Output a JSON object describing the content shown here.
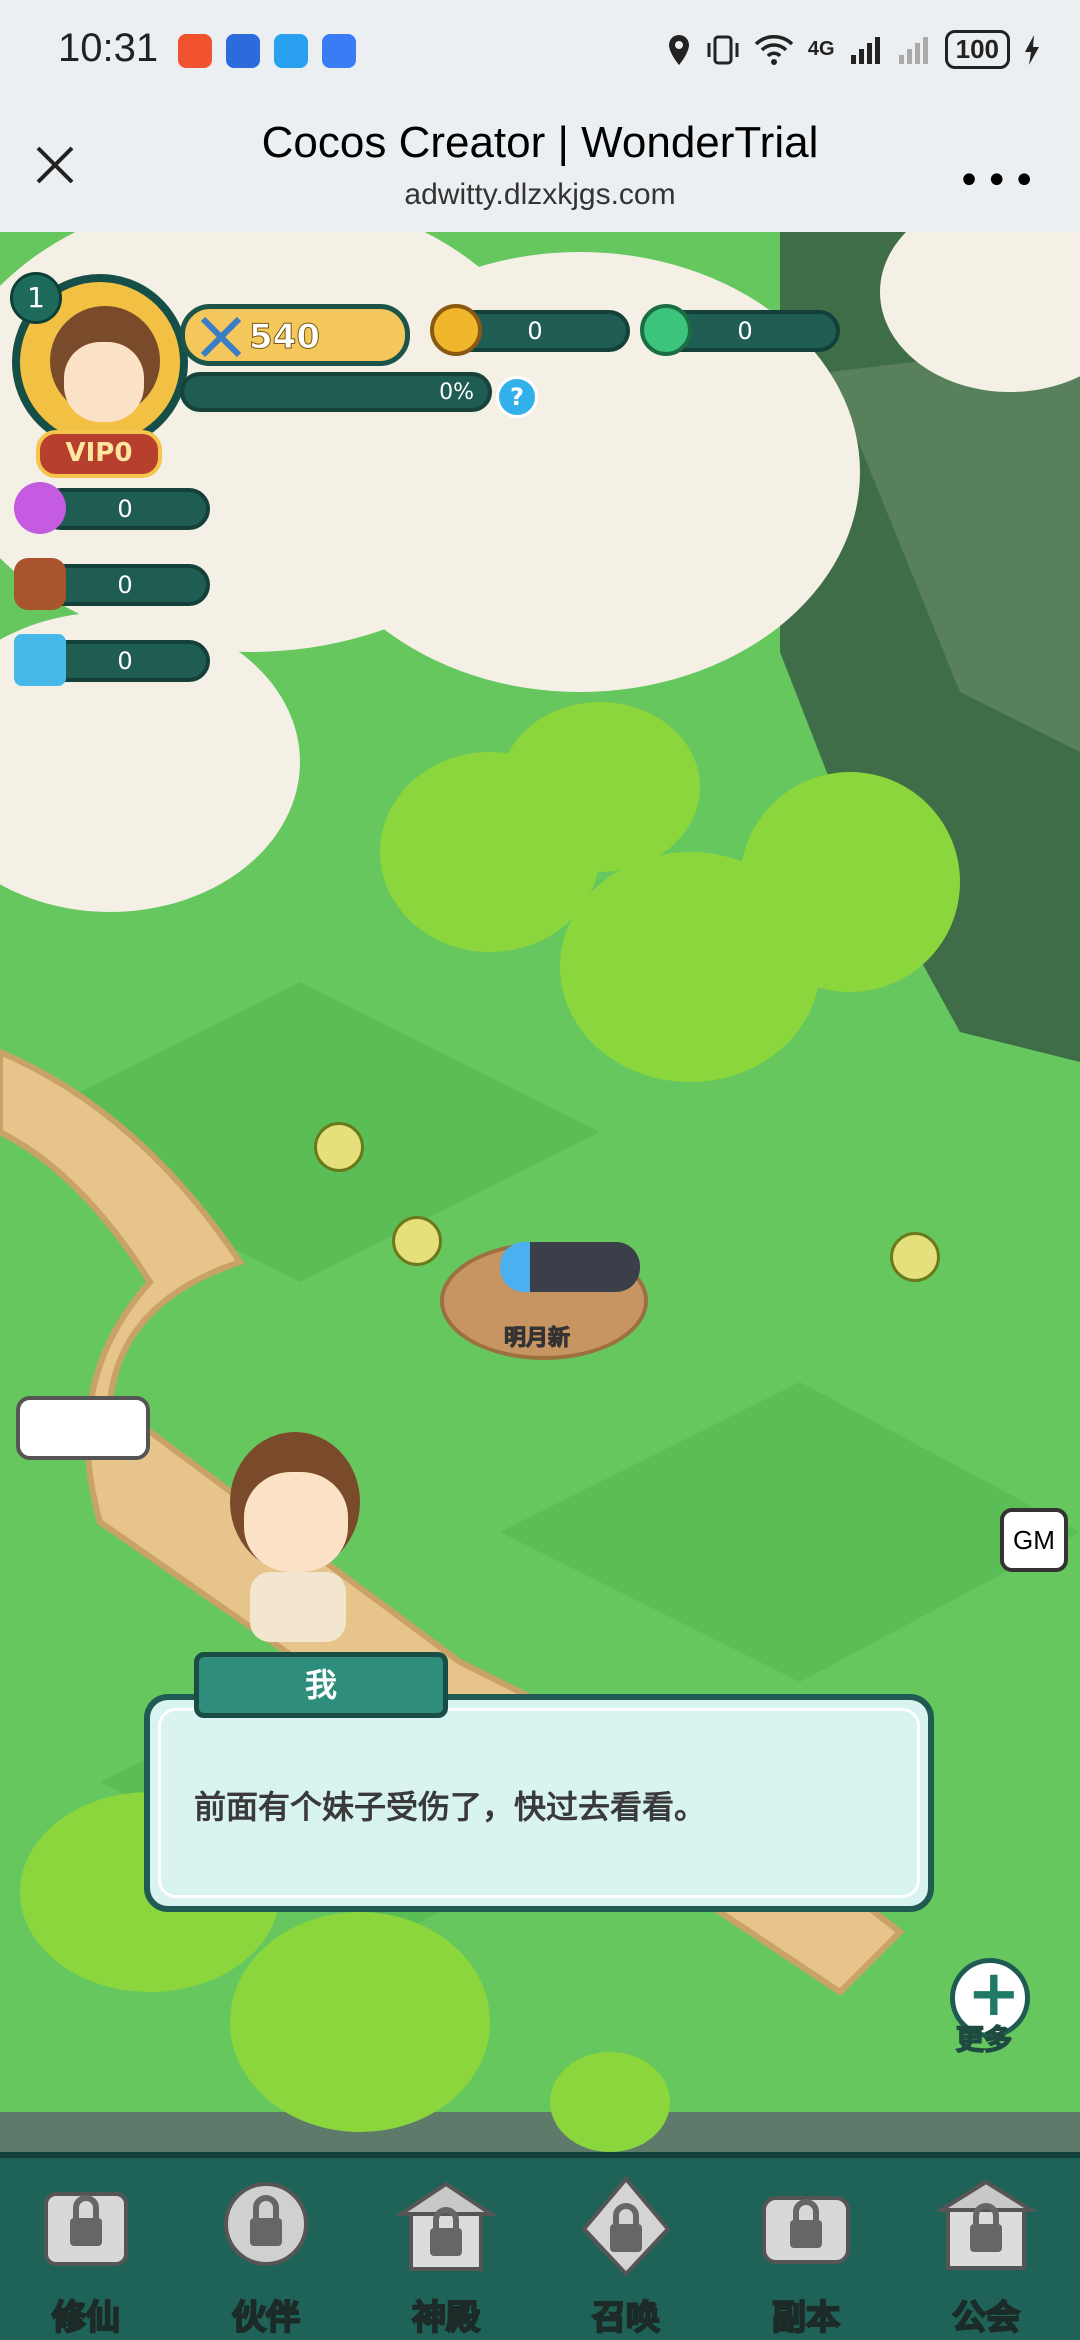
{
  "status_bar": {
    "time": "10:31",
    "network": "4G",
    "battery": "100"
  },
  "browser": {
    "title": "Cocos Creator | WonderTrial",
    "url": "adwitty.dlzxkjgs.com"
  },
  "hud": {
    "level": "1",
    "vip": "VIP0",
    "power": "540",
    "exp_percent": "0%",
    "gold": "0",
    "jade": "0",
    "spirit": "0",
    "wood": "0",
    "crystal": "0"
  },
  "scene": {
    "npc_name": "明月新",
    "gm_label": "GM"
  },
  "dialog": {
    "speaker": "我",
    "text": "前面有个妹子受伤了，快过去看看。"
  },
  "more_label": "更多",
  "nav": [
    {
      "label": "修仙",
      "icon": "scroll-lock-icon"
    },
    {
      "label": "伙伴",
      "icon": "partner-lock-icon"
    },
    {
      "label": "神殿",
      "icon": "temple-lock-icon"
    },
    {
      "label": "召唤",
      "icon": "summon-lock-icon"
    },
    {
      "label": "副本",
      "icon": "dungeon-lock-icon"
    },
    {
      "label": "公会",
      "icon": "guild-lock-icon"
    }
  ]
}
